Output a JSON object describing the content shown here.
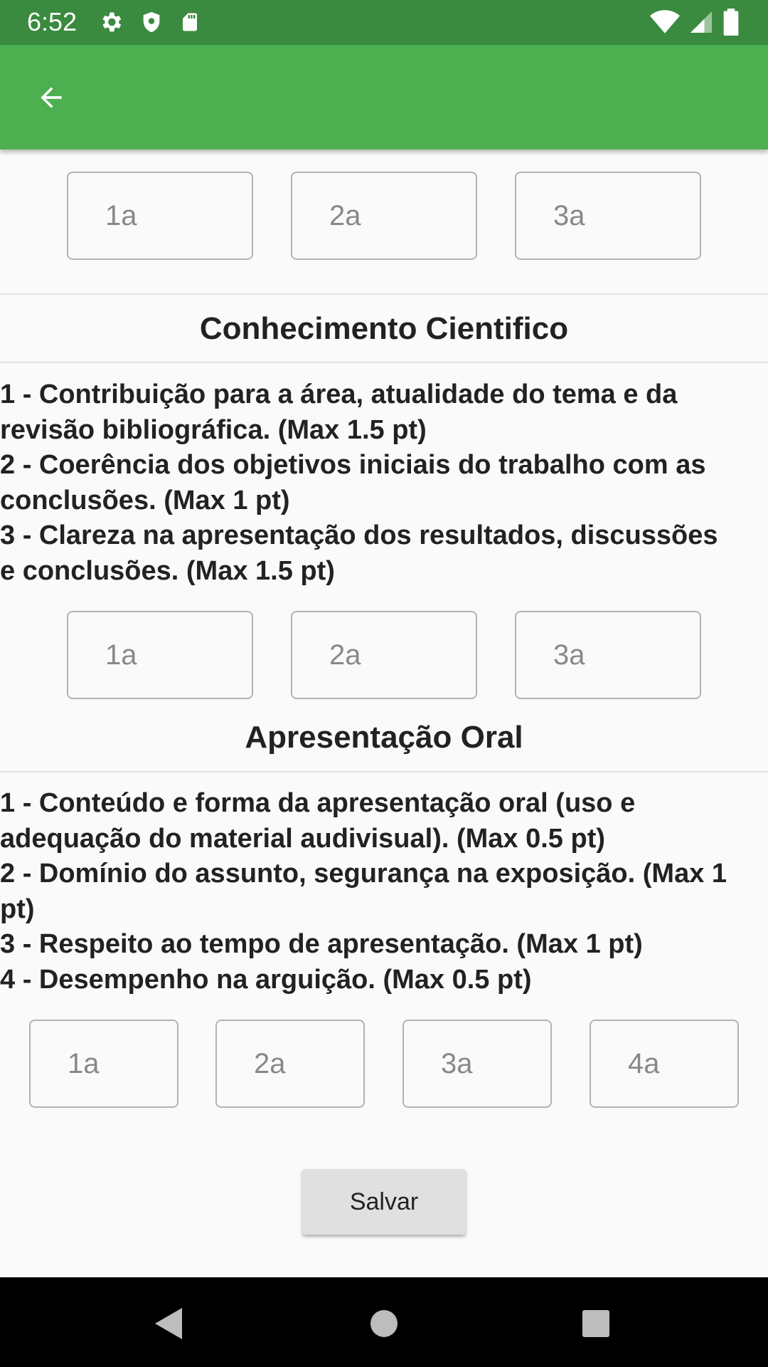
{
  "status_bar": {
    "time": "6:52",
    "icons": [
      "settings-icon",
      "shield-icon",
      "sd-card-icon",
      "wifi-icon",
      "signal-icon",
      "battery-icon"
    ]
  },
  "app_bar": {
    "back_icon": "arrow-back-icon",
    "color": "#4caf50"
  },
  "top_fields": [
    {
      "placeholder": "1a"
    },
    {
      "placeholder": "2a"
    },
    {
      "placeholder": "3a"
    }
  ],
  "section_cientifico": {
    "title": "Conhecimento Cientifico",
    "lines": [
      "1 - Contribuição para a área, atualidade do tema e da",
      "revisão bibliográfica. (Max 1.5 pt)",
      "2 - Coerência dos objetivos iniciais do trabalho com as",
      "conclusões. (Max 1 pt)",
      "3 - Clareza na apresentação dos resultados, discussões",
      "e conclusões. (Max 1.5 pt)"
    ],
    "fields": [
      {
        "placeholder": "1a"
      },
      {
        "placeholder": "2a"
      },
      {
        "placeholder": "3a"
      }
    ]
  },
  "section_oral": {
    "title": "Apresentação Oral",
    "lines": [
      "1 - Conteúdo e forma da apresentação oral (uso e",
      "adequação do material audivisual). (Max 0.5 pt)",
      "2 - Domínio do assunto, segurança na exposição. (Max 1",
      "pt)",
      "3 - Respeito ao tempo de apresentação. (Max 1 pt)",
      "4 - Desempenho na arguição. (Max 0.5 pt)"
    ],
    "fields": [
      {
        "placeholder": "1a"
      },
      {
        "placeholder": "2a"
      },
      {
        "placeholder": "3a"
      },
      {
        "placeholder": "4a"
      }
    ]
  },
  "save_label": "Salvar",
  "nav_bar": {
    "icons": [
      "back-triangle-icon",
      "home-circle-icon",
      "recents-square-icon"
    ]
  }
}
